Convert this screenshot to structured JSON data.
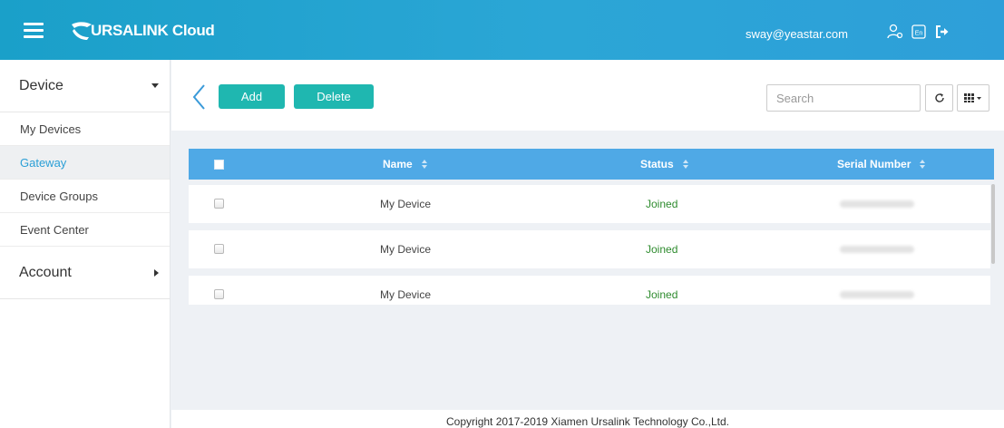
{
  "header": {
    "logo_text": "URSALINK Cloud",
    "user_email": "sway@yeastar.com",
    "icons": [
      "menu-icon",
      "user-settings-icon",
      "language-en-icon",
      "logout-icon"
    ]
  },
  "sidebar": {
    "groups": [
      {
        "label": "Device",
        "expanded": true
      },
      {
        "label": "Account",
        "expanded": false
      }
    ],
    "items": [
      {
        "label": "My Devices"
      },
      {
        "label": "Gateway",
        "active": true
      },
      {
        "label": "Device Groups"
      },
      {
        "label": "Event Center"
      }
    ]
  },
  "toolbar": {
    "add_label": "Add",
    "delete_label": "Delete",
    "search_placeholder": "Search"
  },
  "table": {
    "columns": [
      "Name",
      "Status",
      "Serial Number"
    ],
    "rows": [
      {
        "name": "My Device",
        "status": "Joined"
      },
      {
        "name": "My Device",
        "status": "Joined"
      },
      {
        "name": "My Device",
        "status": "Joined"
      }
    ]
  },
  "footer": {
    "copyright": "Copyright 2017-2019 Xiamen Ursalink Technology Co.,Ltd."
  },
  "colors": {
    "header": "#2ba6d6",
    "table_header": "#4fa9e6",
    "button": "#1fb7b0",
    "status_joined": "#2e8b2e",
    "active_item": "#2b9fd6"
  }
}
